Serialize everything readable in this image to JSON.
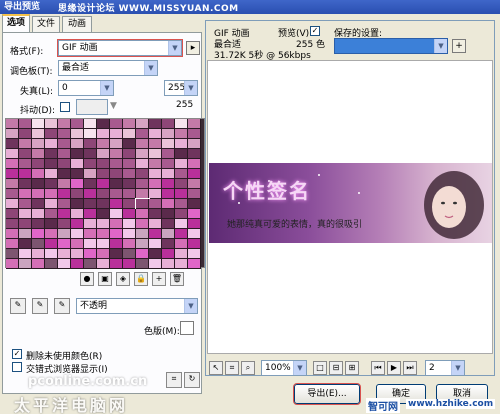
{
  "window": {
    "title": "导出预览",
    "watermark": "思缘设计论坛 WWW.MISSYUAN.COM"
  },
  "tabs": [
    {
      "label": "选项",
      "active": true
    },
    {
      "label": "文件",
      "active": false
    },
    {
      "label": "动画",
      "active": false
    }
  ],
  "options": {
    "format_label": "格式(F):",
    "format_value": "GIF 动画",
    "palette_label": "调色板(T):",
    "palette_value": "最合适",
    "loss_label": "失真(L):",
    "loss_value": "0",
    "colors_value": "255",
    "dither_label": "抖动(D):",
    "dither_checked": false,
    "colors_count": "255",
    "transparency_value": "不透明",
    "matte_label": "色版(M):",
    "remove_unused_label": "删除未使用颜色(R)",
    "remove_unused_checked": true,
    "interlaced_label": "交错式浏览器显示(I)",
    "interlaced_checked": false
  },
  "preview": {
    "format": "GIF 动画",
    "palette": "最合适",
    "stats": "31.72K 5秒 @ 56kbps",
    "preview_label": "预览(V)",
    "preview_checked": true,
    "colors": "255 色",
    "saved_settings_label": "保存的设置:",
    "saved_settings_value": "",
    "banner_title": "个性签名",
    "banner_text": "她那纯真可爱的表情，真的很吸引",
    "zoom_value": "100%",
    "frame_value": "2"
  },
  "buttons": {
    "export": "导出(E)...",
    "ok": "确定",
    "cancel": "取消"
  },
  "footer_watermarks": {
    "left_url": "pconline.com.cn",
    "left_cn": "太平洋电脑网",
    "right_cn": "智可网",
    "right_url": "www.hzhike.com"
  },
  "colors": {
    "title_blue": "#2a4fb0",
    "highlight_red": "#d9534f",
    "saved_setting_blue": "#3c80d8"
  }
}
